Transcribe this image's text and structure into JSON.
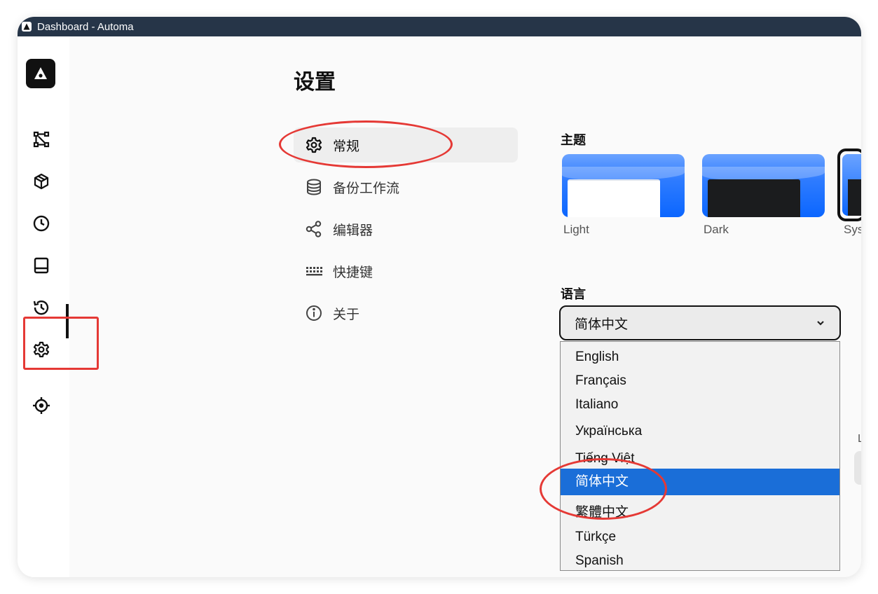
{
  "window": {
    "title": "Dashboard - Automa"
  },
  "sidebar": {
    "items": [
      {
        "name": "workflows",
        "icon": "workflow-icon"
      },
      {
        "name": "packages",
        "icon": "package-icon"
      },
      {
        "name": "schedule",
        "icon": "clock-icon"
      },
      {
        "name": "storage",
        "icon": "storage-icon"
      },
      {
        "name": "logs",
        "icon": "history-icon"
      },
      {
        "name": "settings",
        "icon": "gear-icon",
        "active": true
      },
      {
        "name": "recording",
        "icon": "crosshair-icon"
      }
    ]
  },
  "page": {
    "title": "设置"
  },
  "settings_menu": {
    "items": [
      {
        "label": "常规",
        "icon": "gear-icon",
        "active": true
      },
      {
        "label": "备份工作流",
        "icon": "database-icon"
      },
      {
        "label": "编辑器",
        "icon": "share-nodes-icon"
      },
      {
        "label": "快捷键",
        "icon": "keyboard-icon"
      },
      {
        "label": "关于",
        "icon": "info-icon"
      }
    ]
  },
  "theme": {
    "label": "主题",
    "options": [
      {
        "name": "Light"
      },
      {
        "name": "Dark"
      },
      {
        "name": "Sys"
      }
    ]
  },
  "language": {
    "label": "语言",
    "selected": "简体中文",
    "options": [
      "English",
      "Français",
      "Italiano",
      "Українська",
      "Tiếng Việt",
      "简体中文",
      "繁體中文",
      "Türkçe",
      "Spanish"
    ],
    "highlighted": "简体中文"
  },
  "right_fragment": {
    "label": "L"
  },
  "colors": {
    "titlebar": "#263548",
    "accent_highlight": "#1a6ed8",
    "annotation_red": "#e53935",
    "theme_blue": "#0b66ff"
  }
}
